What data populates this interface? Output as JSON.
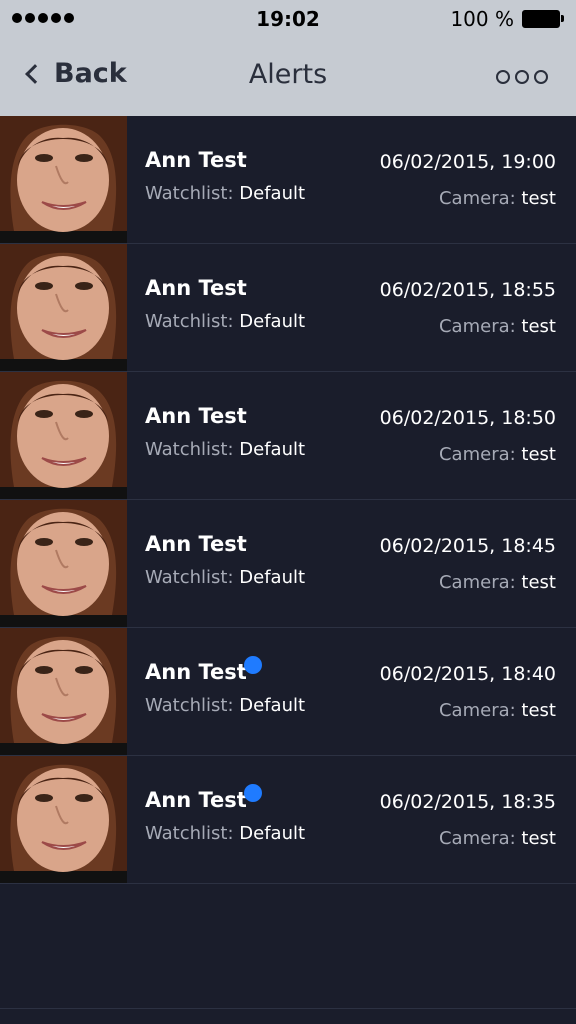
{
  "status_bar": {
    "time": "19:02",
    "battery_percent": "100 %",
    "signal_dots": 5
  },
  "nav": {
    "back_label": "Back",
    "title": "Alerts",
    "more_icon": "more-icon"
  },
  "labels": {
    "watchlist_key": "Watchlist:",
    "camera_key": "Camera:"
  },
  "alerts": [
    {
      "name": "Ann Test",
      "watchlist": "Default",
      "datetime": "06/02/2015, 19:00",
      "camera": "test",
      "unread": false
    },
    {
      "name": "Ann Test",
      "watchlist": "Default",
      "datetime": "06/02/2015, 18:55",
      "camera": "test",
      "unread": false
    },
    {
      "name": "Ann Test",
      "watchlist": "Default",
      "datetime": "06/02/2015, 18:50",
      "camera": "test",
      "unread": false
    },
    {
      "name": "Ann Test",
      "watchlist": "Default",
      "datetime": "06/02/2015, 18:45",
      "camera": "test",
      "unread": false
    },
    {
      "name": "Ann Test",
      "watchlist": "Default",
      "datetime": "06/02/2015, 18:40",
      "camera": "test",
      "unread": true
    },
    {
      "name": "Ann Test",
      "watchlist": "Default",
      "datetime": "06/02/2015, 18:35",
      "camera": "test",
      "unread": true
    }
  ],
  "colors": {
    "background": "#1a1d2b",
    "nav_background": "#c6cbd2",
    "unread_dot": "#1f7bff"
  }
}
